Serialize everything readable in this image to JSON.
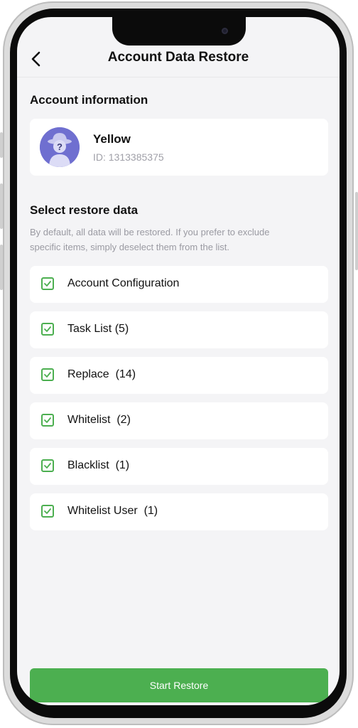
{
  "header": {
    "title": "Account Data Restore",
    "back_icon": "chevron-left-icon"
  },
  "account_section": {
    "title": "Account information",
    "user": {
      "name": "Yellow",
      "id_text": "ID: 1313385375",
      "avatar_icon": "anonymous-user-icon",
      "avatar_color": "#6f6fd0"
    }
  },
  "restore_section": {
    "title": "Select restore data",
    "hint": "By default, all data will be restored. If you prefer to exclude specific items, simply deselect them from the list.",
    "items": [
      {
        "label": "Account Configuration",
        "checked": true
      },
      {
        "label": "Task List (5)",
        "checked": true
      },
      {
        "label": "Replace  (14)",
        "checked": true
      },
      {
        "label": "Whitelist  (2)",
        "checked": true
      },
      {
        "label": "Blacklist  (1)",
        "checked": true
      },
      {
        "label": "Whitelist User  (1)",
        "checked": true
      }
    ]
  },
  "footer": {
    "restore_button_label": "Start Restore"
  },
  "colors": {
    "accent": "#4caf50",
    "background": "#f4f4f6"
  }
}
